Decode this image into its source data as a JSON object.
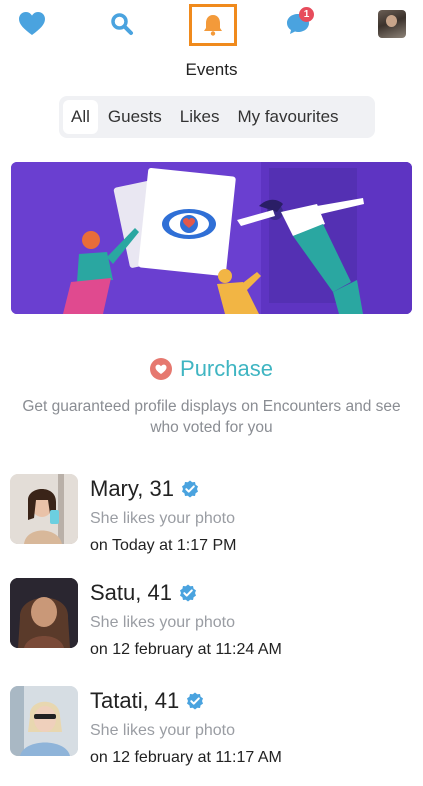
{
  "nav": {
    "chat_badge": "1",
    "colors": {
      "accent_blue": "#4aa3df",
      "bell_orange": "#f39a3a",
      "highlight_border": "#f08a1c",
      "badge_red": "#e74c5c"
    },
    "icons": [
      "heart-icon",
      "search-icon",
      "bell-icon",
      "chat-bubble-icon",
      "user-avatar"
    ]
  },
  "header": {
    "title": "Events"
  },
  "tabs": [
    {
      "label": "All",
      "active": true
    },
    {
      "label": "Guests",
      "active": false
    },
    {
      "label": "Likes",
      "active": false
    },
    {
      "label": "My favourites",
      "active": false
    }
  ],
  "promo": {
    "purchase_label": "Purchase",
    "description": "Get guaranteed profile displays on Encounters and see who voted for you",
    "colors": {
      "banner_bg": "#6a3fd0",
      "purchase_text": "#3fb5c2",
      "purchase_icon_bg": "#e6786f"
    }
  },
  "events": [
    {
      "name": "Mary, 31",
      "action": "She likes your photo",
      "time": "on Today at 1:17 PM",
      "verified": true
    },
    {
      "name": "Satu, 41",
      "action": "She likes your photo",
      "time": "on 12 february at 11:24 AM",
      "verified": true
    },
    {
      "name": "Tatati, 41",
      "action": "She likes your photo",
      "time": "on 12 february at 11:17 AM",
      "verified": true
    }
  ]
}
